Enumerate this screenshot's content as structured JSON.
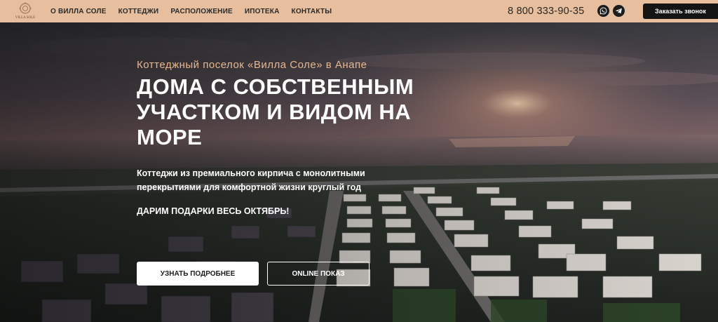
{
  "header": {
    "logo_text": "VILLA SOLE",
    "nav": [
      "О ВИЛЛА СОЛЕ",
      "КОТТЕДЖИ",
      "РАСПОЛОЖЕНИЕ",
      "ИПОТЕКА",
      "КОНТАКТЫ"
    ],
    "phone": "8 800 333-90-35",
    "icons": [
      "whatsapp-icon",
      "telegram-icon"
    ],
    "callback_label": "Заказать звонок"
  },
  "hero": {
    "subtitle": "Коттеджный поселок «Вилла Соле» в Анапе",
    "title": "ДОМА С СОБСТВЕННЫМ УЧАСТКОМ И ВИДОМ НА МОРЕ",
    "description": "Коттеджи из премиального кирпича с монолитными перекрытиями для комфортной жизни круглый год",
    "promo": "ДАРИМ ПОДАРКИ ВЕСЬ ОКТЯБРЬ!",
    "primary_button": "УЗНАТЬ ПОДРОБНЕЕ",
    "secondary_button": "ONLINE ПОКАЗ"
  },
  "colors": {
    "header_bg": "#e7bf9e",
    "accent": "#e8b88f",
    "button_dark": "#141414"
  }
}
